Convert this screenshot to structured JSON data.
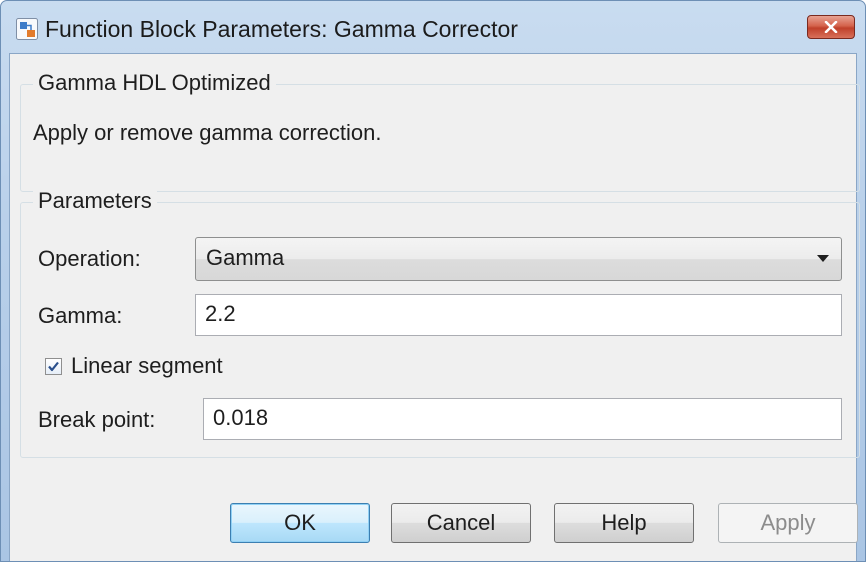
{
  "window": {
    "title": "Function Block Parameters: Gamma Corrector",
    "close_icon": "close-icon",
    "app_icon": "simulink-block-icon"
  },
  "block": {
    "group_title": "Gamma HDL Optimized",
    "description": "Apply or remove gamma correction."
  },
  "parameters": {
    "group_title": "Parameters",
    "operation_label": "Operation:",
    "operation_value": "Gamma",
    "gamma_label": "Gamma:",
    "gamma_value": "2.2",
    "linear_segment_label": "Linear segment",
    "linear_segment_checked": true,
    "break_point_label": "Break point:",
    "break_point_value": "0.018"
  },
  "buttons": {
    "ok": "OK",
    "cancel": "Cancel",
    "help": "Help",
    "apply": "Apply"
  },
  "colors": {
    "accent": "#3c7fb1",
    "close_red": "#c0402a"
  }
}
